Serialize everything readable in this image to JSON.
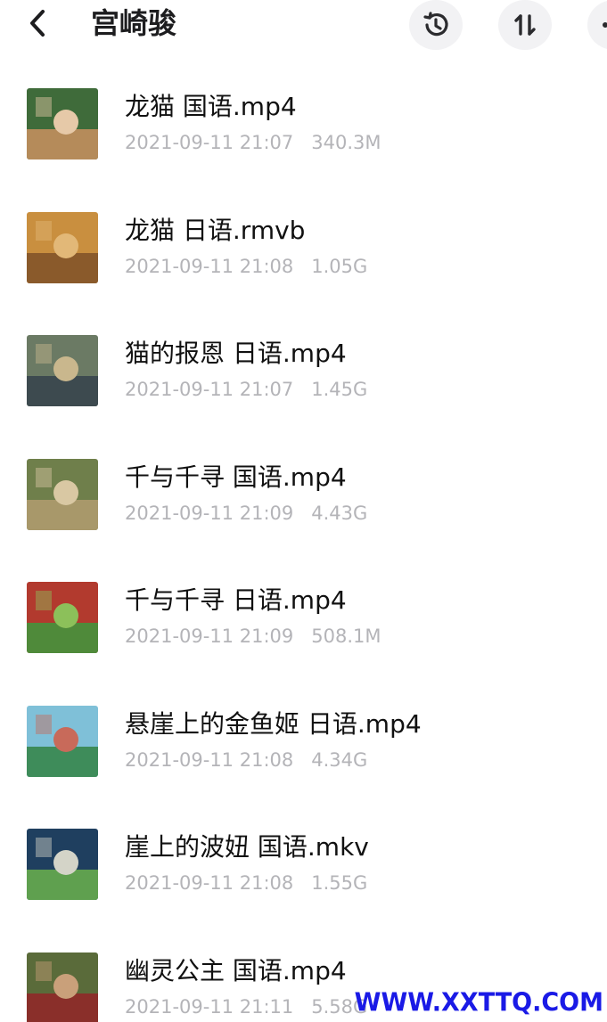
{
  "header": {
    "title": "宫崎骏",
    "back_icon": "chevron-left-icon",
    "history_icon": "history-icon",
    "sort_icon": "sort-icon",
    "more_icon": "more-icon"
  },
  "files": [
    {
      "name": "龙猫 国语.mp4",
      "date": "2021-09-11 21:07",
      "size": "340.3M",
      "thumb_colors": [
        "#3f6b3a",
        "#b58b5a",
        "#e6c9a8"
      ]
    },
    {
      "name": "龙猫 日语.rmvb",
      "date": "2021-09-11 21:08",
      "size": "1.05G",
      "thumb_colors": [
        "#c98f3f",
        "#8a5a2b",
        "#e2b878"
      ]
    },
    {
      "name": "猫的报恩 日语.mp4",
      "date": "2021-09-11 21:07",
      "size": "1.45G",
      "thumb_colors": [
        "#6b7a64",
        "#3d4a4f",
        "#c9b78d"
      ]
    },
    {
      "name": "千与千寻 国语.mp4",
      "date": "2021-09-11 21:09",
      "size": "4.43G",
      "thumb_colors": [
        "#6f7f4b",
        "#a8986a",
        "#d9c8a3"
      ]
    },
    {
      "name": "千与千寻 日语.mp4",
      "date": "2021-09-11 21:09",
      "size": "508.1M",
      "thumb_colors": [
        "#b23a2e",
        "#4f8a3a",
        "#8cc05a"
      ]
    },
    {
      "name": "悬崖上的金鱼姬 日语.mp4",
      "date": "2021-09-11 21:08",
      "size": "4.34G",
      "thumb_colors": [
        "#7fc0d8",
        "#3e8c5a",
        "#c86a5a"
      ]
    },
    {
      "name": "崖上的波妞 国语.mkv",
      "date": "2021-09-11 21:08",
      "size": "1.55G",
      "thumb_colors": [
        "#1f3f5f",
        "#5fa04f",
        "#d4d4c8"
      ]
    },
    {
      "name": "幽灵公主 国语.mp4",
      "date": "2021-09-11 21:11",
      "size": "5.58G",
      "thumb_colors": [
        "#5a6b3a",
        "#8a2f2a",
        "#c9a07a"
      ]
    }
  ],
  "watermark": "WWW.XXTTQ.COM"
}
